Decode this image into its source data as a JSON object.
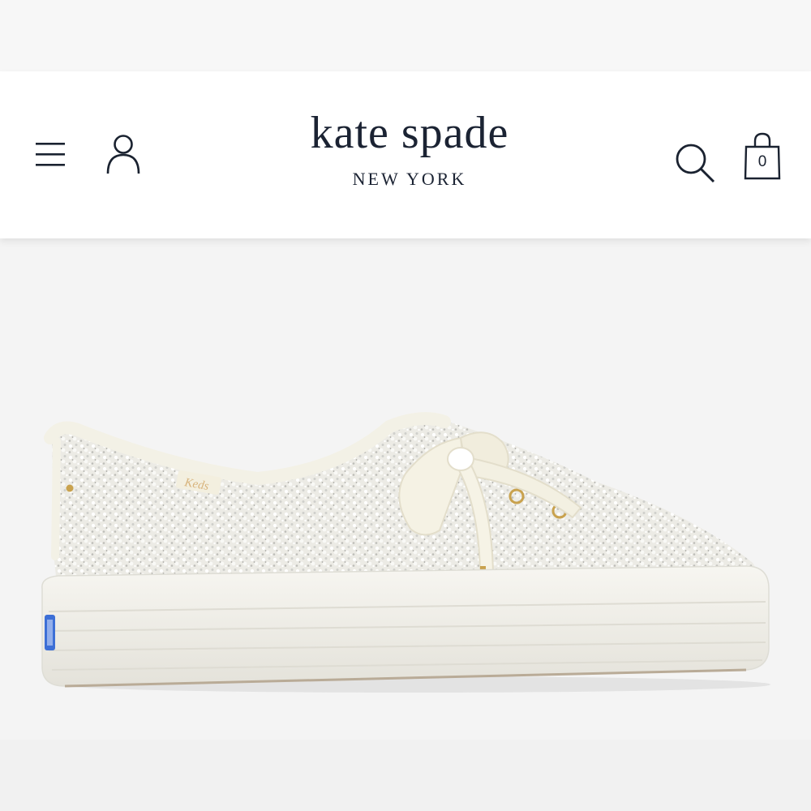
{
  "header": {
    "brand_name": "kate spade",
    "brand_tagline": "NEW YORK",
    "cart_count": "0",
    "icons": {
      "menu": "hamburger-menu-icon",
      "account": "user-icon",
      "search": "search-icon",
      "cart": "shopping-bag-icon"
    }
  },
  "product_image": {
    "label_text": "Keds"
  },
  "colors": {
    "brand_navy": "#1b2333",
    "background": "#f4f4f4",
    "header_bg": "#ffffff",
    "keds_blue": "#3d6fd6"
  }
}
